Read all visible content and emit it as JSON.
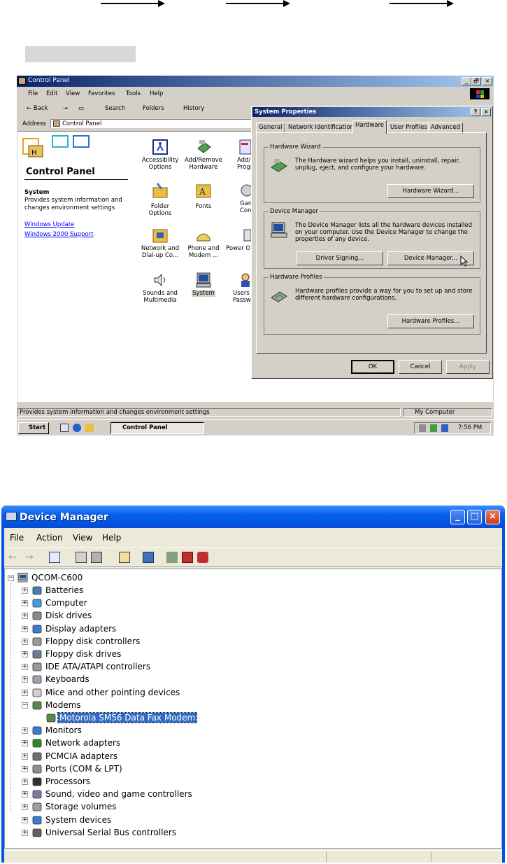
{
  "win2000": {
    "window_title": "Control Panel",
    "title_buttons": [
      "_",
      "🗗",
      "×"
    ],
    "menu": [
      "File",
      "Edit",
      "View",
      "Favorites",
      "Tools",
      "Help"
    ],
    "toolbar": [
      "← Back",
      "→",
      "Search",
      "Folders",
      "History"
    ],
    "address_label": "Address",
    "address_value": "Control Panel",
    "panel_title": "Control Panel",
    "selected_name": "System",
    "selected_desc": "Provides system information and changes environment settings",
    "links": [
      "Windows Update",
      "Windows 2000 Support"
    ],
    "icons": [
      {
        "label": "Accessibility Options",
        "icon": "accessibility-icon"
      },
      {
        "label": "Add/Remove Hardware",
        "icon": "hardware-icon"
      },
      {
        "label": "Add/Re Progr",
        "icon": "programs-icon"
      },
      {
        "label": "Folder Options",
        "icon": "folder-options-icon"
      },
      {
        "label": "Fonts",
        "icon": "fonts-icon"
      },
      {
        "label": "Gan Contro",
        "icon": "game-controllers-icon"
      },
      {
        "label": "Network and Dial-up Co...",
        "icon": "network-icon"
      },
      {
        "label": "Phone and Modem ...",
        "icon": "phone-modem-icon"
      },
      {
        "label": "Power O",
        "icon": "power-icon"
      },
      {
        "label": "Sounds and Multimedia",
        "icon": "sounds-icon"
      },
      {
        "label": "System",
        "icon": "system-icon"
      },
      {
        "label": "Users Passw",
        "icon": "users-icon"
      }
    ],
    "status_text": "Provides system information and changes environment settings",
    "status_zone": "My Computer",
    "start_label": "Start",
    "task_label": "Control Panel",
    "clock": "7:56 PM",
    "dialog": {
      "title": "System Properties",
      "title_buttons": [
        "?",
        "×"
      ],
      "tabs": [
        "General",
        "Network Identification",
        "Hardware",
        "User Profiles",
        "Advanced"
      ],
      "active_tab": "Hardware",
      "groups": [
        {
          "caption": "Hardware Wizard",
          "text": "The Hardware wizard helps you install, uninstall, repair, unplug, eject, and configure your hardware.",
          "buttons": [
            "Hardware Wizard..."
          ]
        },
        {
          "caption": "Device Manager",
          "text": "The Device Manager lists all the hardware devices installed on your computer. Use the Device Manager to change the properties of any device.",
          "buttons": [
            "Driver Signing...",
            "Device Manager..."
          ]
        },
        {
          "caption": "Hardware Profiles",
          "text": "Hardware profiles provide a way for you to set up and store different hardware configurations.",
          "buttons": [
            "Hardware Profiles..."
          ]
        }
      ],
      "footer_buttons": [
        "OK",
        "Cancel",
        "Apply"
      ]
    }
  },
  "device_manager": {
    "window_title": "Device Manager",
    "menu": [
      "File",
      "Action",
      "View",
      "Help"
    ],
    "root": "QCOM-C600",
    "root_expander": "−",
    "items": [
      {
        "label": "Batteries",
        "icon": "battery-icon",
        "expander": "+"
      },
      {
        "label": "Computer",
        "icon": "computer-icon",
        "expander": "+"
      },
      {
        "label": "Disk drives",
        "icon": "disk-drive-icon",
        "expander": "+"
      },
      {
        "label": "Display adapters",
        "icon": "display-adapter-icon",
        "expander": "+"
      },
      {
        "label": "Floppy disk controllers",
        "icon": "floppy-controller-icon",
        "expander": "+"
      },
      {
        "label": "Floppy disk drives",
        "icon": "floppy-drive-icon",
        "expander": "+"
      },
      {
        "label": "IDE ATA/ATAPI controllers",
        "icon": "ide-controller-icon",
        "expander": "+"
      },
      {
        "label": "Keyboards",
        "icon": "keyboard-icon",
        "expander": "+"
      },
      {
        "label": "Mice and other pointing devices",
        "icon": "mouse-icon",
        "expander": "+"
      },
      {
        "label": "Modems",
        "icon": "modem-icon",
        "expander": "−"
      },
      {
        "label": "Motorola SM56 Data Fax Modem",
        "icon": "modem-icon",
        "expander": "",
        "child": true,
        "selected": true
      },
      {
        "label": "Monitors",
        "icon": "monitor-icon",
        "expander": "+"
      },
      {
        "label": "Network adapters",
        "icon": "network-adapter-icon",
        "expander": "+"
      },
      {
        "label": "PCMCIA adapters",
        "icon": "pcmcia-icon",
        "expander": "+"
      },
      {
        "label": "Ports (COM & LPT)",
        "icon": "port-icon",
        "expander": "+"
      },
      {
        "label": "Processors",
        "icon": "processor-icon",
        "expander": "+"
      },
      {
        "label": "Sound, video and game controllers",
        "icon": "sound-icon",
        "expander": "+"
      },
      {
        "label": "Storage volumes",
        "icon": "storage-icon",
        "expander": "+"
      },
      {
        "label": "System devices",
        "icon": "system-device-icon",
        "expander": "+"
      },
      {
        "label": "Universal Serial Bus controllers",
        "icon": "usb-icon",
        "expander": "+"
      }
    ],
    "title_buttons": [
      "_",
      "□",
      "×"
    ]
  }
}
